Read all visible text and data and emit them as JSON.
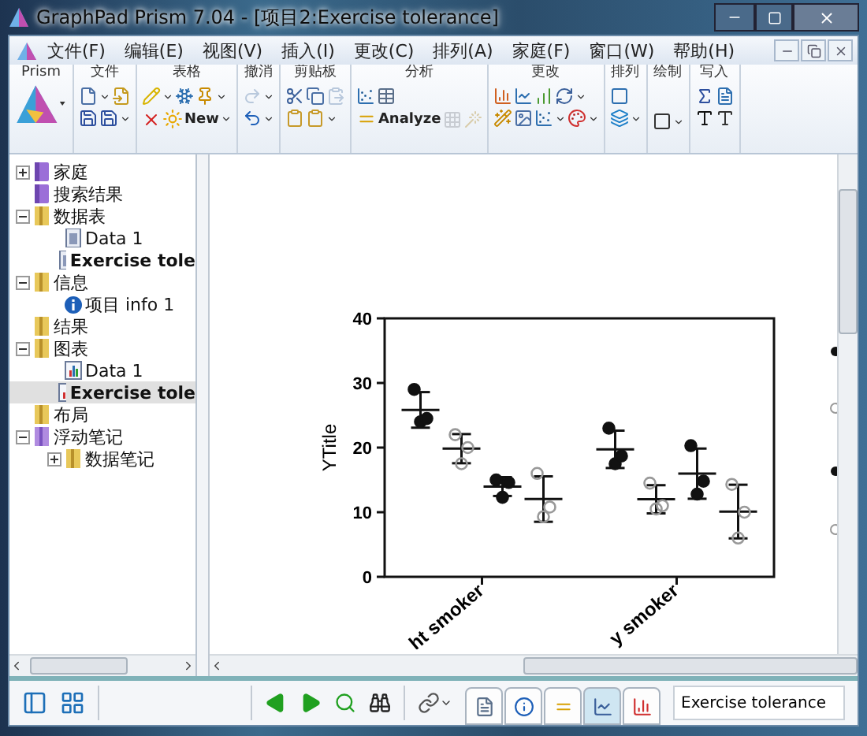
{
  "window": {
    "title": "GraphPad Prism 7.04 - [项目2:Exercise tolerance]"
  },
  "menu": [
    "文件(F)",
    "编辑(E)",
    "视图(V)",
    "插入(I)",
    "更改(C)",
    "排列(A)",
    "家庭(F)",
    "窗口(W)",
    "帮助(H)"
  ],
  "ribbon": [
    {
      "label": "Prism"
    },
    {
      "label": "文件"
    },
    {
      "label": "表格",
      "buttons": [
        "New"
      ]
    },
    {
      "label": "撤消"
    },
    {
      "label": "剪贴板"
    },
    {
      "label": "分析",
      "buttons": [
        "Analyze"
      ]
    },
    {
      "label": "更改"
    },
    {
      "label": "排列"
    },
    {
      "label": "绘制"
    },
    {
      "label": "写入"
    }
  ],
  "navigator": [
    {
      "label": "家庭",
      "kind": "book",
      "expanded": false,
      "selected": false,
      "current": false
    },
    {
      "label": "搜索结果",
      "kind": "book",
      "selected": false,
      "current": false
    },
    {
      "label": "数据表",
      "kind": "folder",
      "expanded": true,
      "selected": false,
      "current": false,
      "children": [
        {
          "label": "Data 1",
          "kind": "table",
          "selected": false,
          "current": false
        },
        {
          "label": "Exercise tole",
          "kind": "table",
          "selected": false,
          "current": true
        }
      ]
    },
    {
      "label": "信息",
      "kind": "folder",
      "expanded": true,
      "selected": false,
      "current": false,
      "children": [
        {
          "label": "项目 info 1",
          "kind": "info",
          "selected": false,
          "current": false
        }
      ]
    },
    {
      "label": "结果",
      "kind": "folder",
      "selected": false,
      "current": false
    },
    {
      "label": "图表",
      "kind": "folder",
      "expanded": true,
      "selected": false,
      "current": false,
      "children": [
        {
          "label": "Data 1",
          "kind": "graph",
          "selected": false,
          "current": false
        },
        {
          "label": "Exercise tole",
          "kind": "graph",
          "selected": true,
          "current": true
        }
      ]
    },
    {
      "label": "布局",
      "kind": "folder",
      "selected": false,
      "current": false
    },
    {
      "label": "浮动笔记",
      "kind": "notes",
      "expanded": true,
      "selected": false,
      "current": false,
      "children": [
        {
          "label": "数据笔记",
          "kind": "folder",
          "expanded": false,
          "selected": false,
          "current": false
        }
      ]
    }
  ],
  "graph": {
    "chart_data": {
      "type": "scatter",
      "ylabel": "YTitle",
      "categories": [
        "ht smoker",
        "y smoker"
      ],
      "ylim": [
        0,
        40
      ],
      "yticks": [
        0,
        10,
        20,
        30,
        40
      ],
      "series": [
        {
          "marker": "circle",
          "color": "#111111",
          "values": [
            29,
            23
          ]
        },
        {
          "marker": "circle",
          "color": "#111111",
          "values": [
            24,
            17.5
          ]
        },
        {
          "marker": "circle",
          "color": "#111111",
          "values": [
            24.5,
            18.7
          ]
        },
        {
          "marker": "circle",
          "color": "#999999",
          "values": [
            22,
            14.5
          ]
        },
        {
          "marker": "circle",
          "color": "#999999",
          "values": [
            17.5,
            10.5
          ]
        },
        {
          "marker": "circle",
          "color": "#999999",
          "values": [
            20,
            11
          ]
        },
        {
          "marker": "circle",
          "color": "#111111",
          "values": [
            15,
            20.3
          ]
        },
        {
          "marker": "circle",
          "color": "#111111",
          "values": [
            12.3,
            12.8
          ]
        },
        {
          "marker": "circle",
          "color": "#111111",
          "values": [
            14.6,
            14.8
          ]
        },
        {
          "marker": "circle",
          "color": "#999999",
          "values": [
            16,
            14.3
          ]
        },
        {
          "marker": "circle",
          "color": "#999999",
          "values": [
            9.3,
            6
          ]
        },
        {
          "marker": "circle",
          "color": "#999999",
          "values": [
            10.8,
            10
          ]
        }
      ]
    }
  },
  "bottom_bar": {
    "sheet_tabs": [
      {
        "selected": false
      },
      {
        "selected": false
      },
      {
        "selected": false
      },
      {
        "selected": true
      },
      {
        "selected": false
      }
    ],
    "sheet_name": "Exercise tolerance"
  }
}
